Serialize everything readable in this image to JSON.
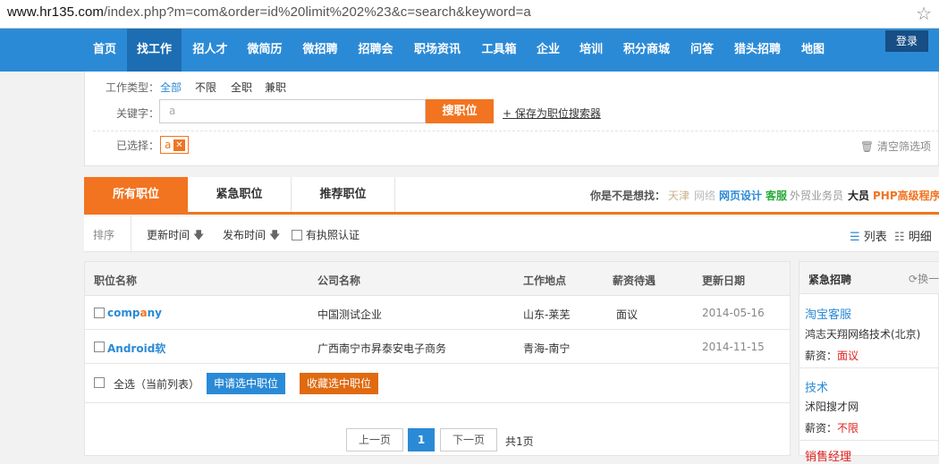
{
  "browser": {
    "url_domain": "www.hr135.com",
    "url_path": "/index.php?m=com&order=id%20limit%202%23&c=search&keyword=a"
  },
  "nav": {
    "items": [
      "首页",
      "找工作",
      "招人才",
      "微简历",
      "微招聘",
      "招聘会",
      "职场资讯",
      "工具箱",
      "企业",
      "培训",
      "积分商城",
      "问答",
      "猎头招聘",
      "地图"
    ],
    "login": "登录"
  },
  "filters": {
    "job_type_label": "工作类型：",
    "job_types": [
      "全部",
      "不限",
      "全职",
      "兼职"
    ],
    "keyword_label": "关键字：",
    "keyword_value": "a",
    "search_button": "搜职位",
    "save_link": "+ 保存为职位搜索器",
    "selected_label": "已选择：",
    "selected_tag": "a",
    "clear": "清空筛选项"
  },
  "tabs": [
    "所有职位",
    "紧急职位",
    "推荐职位"
  ],
  "suggest": {
    "label": "你是不是想找：",
    "items": [
      "天津",
      "网络",
      "网页设计",
      "客服",
      "外贸业务员",
      "大员",
      "PHP高级程序"
    ]
  },
  "sort": {
    "label": "排序",
    "update_time": "更新时间",
    "publish_time": "发布时间",
    "license": "有执照认证",
    "view_list": "列表",
    "view_detail": "明细"
  },
  "table": {
    "headers": [
      "职位名称",
      "公司名称",
      "工作地点",
      "薪资待遇",
      "更新日期"
    ],
    "rows": [
      {
        "job_pre": "comp",
        "job_hl": "a",
        "job_post": "ny",
        "company": "中国测试企业",
        "location": "山东-莱芜",
        "salary": "面议",
        "date": "2014-05-16"
      },
      {
        "job_pre": "Android软",
        "job_hl": "",
        "job_post": "",
        "company": "广西南宁市昇泰安电子商务",
        "location": "青海-南宁",
        "salary": "",
        "date": "2014-11-15"
      }
    ],
    "select_all": "全选（当前列表）",
    "apply_btn": "申请选中职位",
    "fav_btn": "收藏选中职位"
  },
  "pagination": {
    "prev": "上一页",
    "current": "1",
    "next": "下一页",
    "total": "共1页"
  },
  "sidebar": {
    "title": "紧急招聘",
    "refresh": "换一",
    "jobs": [
      {
        "title": "淘宝客服",
        "company": "鸿志天翔网络技术(北京)",
        "salary_label": "薪资：",
        "salary": "面议"
      },
      {
        "title": "技术",
        "company": "沭阳搜才网",
        "salary_label": "薪资：",
        "salary": "不限"
      },
      {
        "title": "销售经理"
      }
    ]
  },
  "colors": {
    "primary": "#2b8ad6",
    "accent": "#f27420",
    "nav_active": "#1d6db3"
  }
}
